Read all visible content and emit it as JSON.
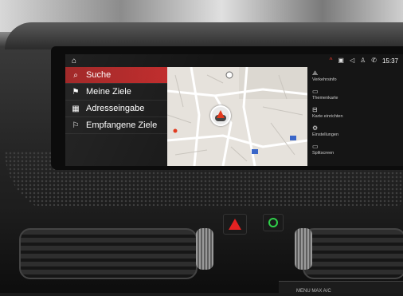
{
  "status_bar": {
    "home_icon": "home-icon",
    "indicators": [
      {
        "name": "warning-chevron-icon",
        "text": "^",
        "color": "#ff3b2f"
      },
      {
        "name": "nav-square-icon",
        "text": "▣"
      },
      {
        "name": "volume-icon",
        "text": "◁"
      },
      {
        "name": "user-icon",
        "text": "♙"
      },
      {
        "name": "signal-icon",
        "text": "✆"
      }
    ],
    "time": "15:37"
  },
  "menu": {
    "items": [
      {
        "label": "Suche",
        "icon": "search-icon",
        "glyph": "⌕",
        "active": true
      },
      {
        "label": "Meine Ziele",
        "icon": "flag-icon",
        "glyph": "⚑",
        "active": false
      },
      {
        "label": "Adresseingabe",
        "icon": "buildings-icon",
        "glyph": "▦",
        "active": false
      },
      {
        "label": "Empfangene Ziele",
        "icon": "received-flag-icon",
        "glyph": "⚐",
        "active": false
      }
    ]
  },
  "right_panel": {
    "items": [
      {
        "label": "Verkehrsinfo",
        "icon": "traffic-icon",
        "glyph": "⟁"
      },
      {
        "label": "Themenkarte",
        "icon": "map-theme-icon",
        "glyph": "▭"
      },
      {
        "label": "Karte einrichten",
        "icon": "map-settings-icon",
        "glyph": "⊟"
      },
      {
        "label": "Einstellungen",
        "icon": "gear-icon",
        "glyph": "⚙"
      },
      {
        "label": "Splitscreen",
        "icon": "splitscreen-icon",
        "glyph": "▭"
      }
    ]
  },
  "console": {
    "hazard_icon": "hazard-triangle-icon",
    "button_label": "MENU  MAX  A/C"
  },
  "colors": {
    "accent": "#c02b2b",
    "menu_bg": "#1b1b1b",
    "map_bg": "#e6e2dc"
  }
}
